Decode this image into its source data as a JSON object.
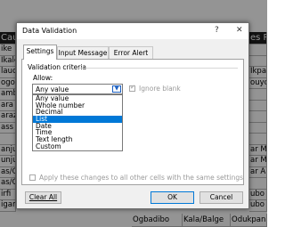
{
  "sheet": {
    "header_left": "Cauc",
    "header_right": "es R",
    "left_cells": [
      "ike",
      "Ikale",
      "lauch",
      "ogor",
      "amba",
      "ara",
      "araza",
      "ass",
      "",
      "anju",
      "unjur",
      "as/G",
      "as/G",
      "irfi",
      "igam"
    ],
    "right_cells": [
      "",
      "",
      "Ikpa",
      "ouyc",
      "",
      "",
      "",
      "",
      "",
      "ar M",
      "ar Ma",
      "ar A",
      "",
      "ubo",
      "ubo"
    ],
    "bottom_cells": [
      "Ogbadibo",
      "Kala/Balge",
      "Odukpani"
    ]
  },
  "dialog": {
    "title": "Data Validation",
    "help_label": "?",
    "close_label": "✕",
    "tabs": [
      "Settings",
      "Input Message",
      "Error Alert"
    ],
    "criteria_label": "Validation criteria",
    "allow_label": "Allow:",
    "allow_value": "Any value",
    "ignore_blank_label": "Ignore blank",
    "options": [
      "Any value",
      "Whole number",
      "Decimal",
      "List",
      "Date",
      "Time",
      "Text length",
      "Custom"
    ],
    "selected_option": "List",
    "apply_label": "Apply these changes to all other cells with the same settings",
    "clear_all_label": "Clear All",
    "ok_label": "OK",
    "cancel_label": "Cancel"
  }
}
